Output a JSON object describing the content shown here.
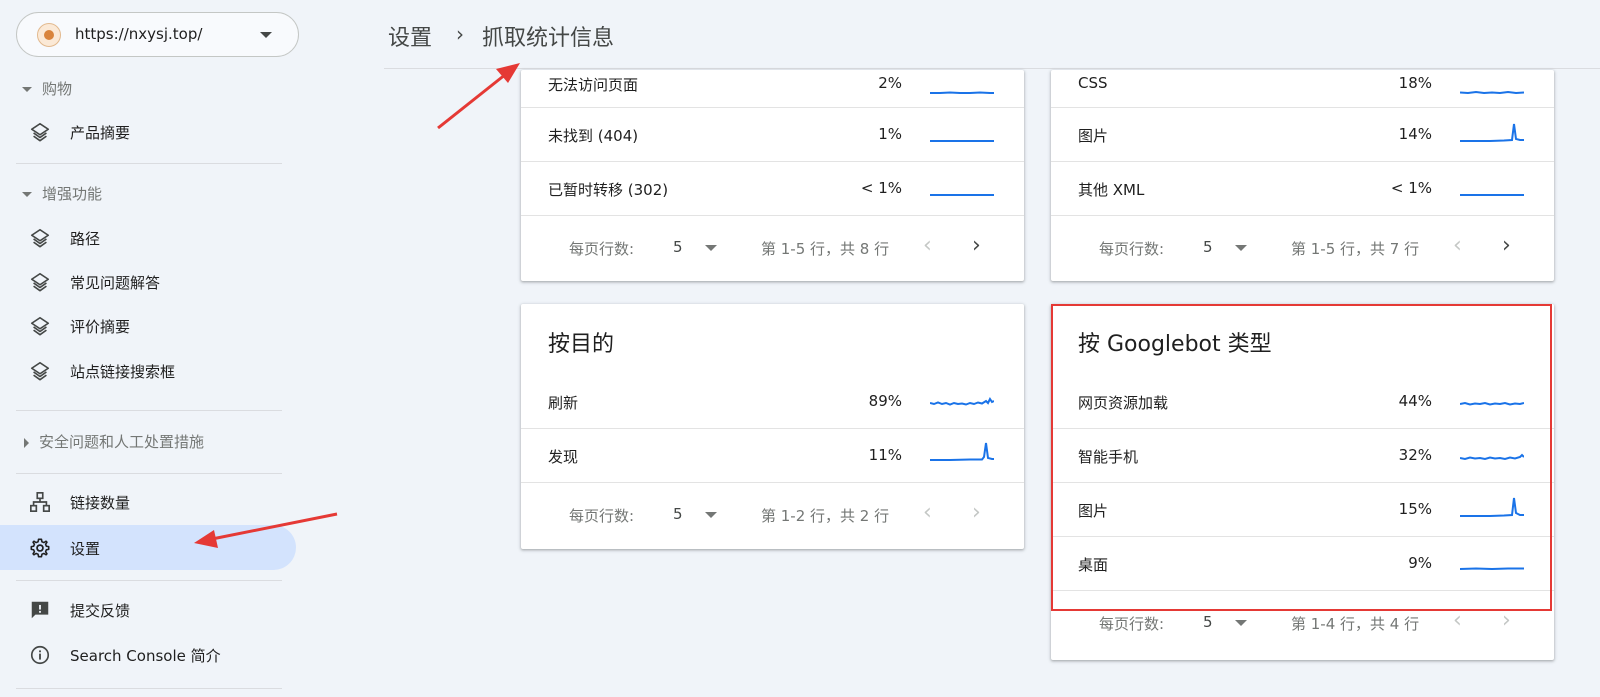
{
  "property": {
    "url": "https://nxysj.top/"
  },
  "sidebar": {
    "sections": [
      {
        "label": "购物"
      },
      {
        "label": "增强功能"
      },
      {
        "label": "安全问题和人工处置措施"
      }
    ],
    "items": [
      {
        "label": "产品摘要",
        "icon": "layers-icon"
      },
      {
        "label": "路径",
        "icon": "layers-icon"
      },
      {
        "label": "常见问题解答",
        "icon": "layers-icon"
      },
      {
        "label": "评价摘要",
        "icon": "layers-icon"
      },
      {
        "label": "站点链接搜索框",
        "icon": "layers-icon"
      },
      {
        "label": "链接数量",
        "icon": "sitemap-icon"
      },
      {
        "label": "设置",
        "icon": "gear-icon",
        "active": true
      },
      {
        "label": "提交反馈",
        "icon": "feedback-icon"
      },
      {
        "label": "Search Console 简介",
        "icon": "info-icon"
      }
    ]
  },
  "breadcrumb": {
    "parent": "设置",
    "separator": "›",
    "current": "抓取统计信息"
  },
  "cards": {
    "response": {
      "rows": [
        {
          "label": "无法访问页面",
          "value": "2%"
        },
        {
          "label": "未找到 (404)",
          "value": "1%"
        },
        {
          "label": "已暂时转移 (302)",
          "value": "< 1%"
        }
      ],
      "pager": {
        "label": "每页行数:",
        "per_page": "5",
        "range": "第 1-5 行，共 8 行"
      }
    },
    "filetype": {
      "rows": [
        {
          "label": "CSS",
          "value": "18%"
        },
        {
          "label": "图片",
          "value": "14%"
        },
        {
          "label": "其他 XML",
          "value": "< 1%"
        }
      ],
      "pager": {
        "label": "每页行数:",
        "per_page": "5",
        "range": "第 1-5 行，共 7 行"
      }
    },
    "purpose": {
      "title": "按目的",
      "rows": [
        {
          "label": "刷新",
          "value": "89%"
        },
        {
          "label": "发现",
          "value": "11%"
        }
      ],
      "pager": {
        "label": "每页行数:",
        "per_page": "5",
        "range": "第 1-2 行，共 2 行"
      }
    },
    "googlebot": {
      "title": "按 Googlebot 类型",
      "rows": [
        {
          "label": "网页资源加载",
          "value": "44%"
        },
        {
          "label": "智能手机",
          "value": "32%"
        },
        {
          "label": "图片",
          "value": "15%"
        },
        {
          "label": "桌面",
          "value": "9%"
        }
      ],
      "pager": {
        "label": "每页行数:",
        "per_page": "5",
        "range": "第 1-4 行，共 4 行"
      }
    }
  },
  "colors": {
    "accent": "#1a73e8",
    "active_bg": "#d3e3fd",
    "highlight": "#e53935",
    "page_bg": "#f0f4f9"
  }
}
